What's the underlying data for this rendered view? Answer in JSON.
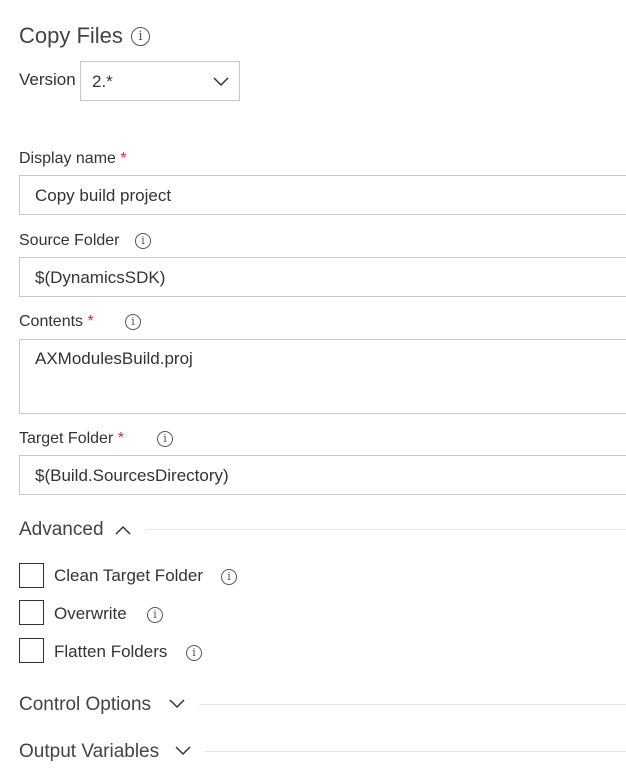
{
  "task": {
    "title": "Copy Files",
    "title_icon": "info-icon"
  },
  "version": {
    "label": "Version",
    "value": "2.*",
    "icon": "chevron-down-icon"
  },
  "fields": {
    "display_name": {
      "label": "Display name",
      "required_marker": "*",
      "value": "Copy build project"
    },
    "source_folder": {
      "label": "Source Folder",
      "value": "$(DynamicsSDK)",
      "icon": "info-icon"
    },
    "contents": {
      "label": "Contents",
      "required_marker": "*",
      "value": "AXModulesBuild.proj",
      "icon": "info-icon"
    },
    "target_folder": {
      "label": "Target Folder",
      "required_marker": "*",
      "value": "$(Build.SourcesDirectory)",
      "icon": "info-icon"
    }
  },
  "advanced": {
    "label": "Advanced",
    "expanded": true,
    "icon": "chevron-up-icon",
    "options": [
      {
        "label": "Clean Target Folder",
        "checked": false,
        "icon": "info-icon"
      },
      {
        "label": "Overwrite",
        "checked": false,
        "icon": "info-icon"
      },
      {
        "label": "Flatten Folders",
        "checked": false,
        "icon": "info-icon"
      }
    ]
  },
  "control_options": {
    "label": "Control Options",
    "expanded": false,
    "icon": "chevron-down-icon"
  },
  "output_variables": {
    "label": "Output Variables",
    "expanded": false,
    "icon": "chevron-down-icon"
  },
  "colors": {
    "required": "#c4314b",
    "border": "#c8c8c8",
    "text": "#333333"
  }
}
